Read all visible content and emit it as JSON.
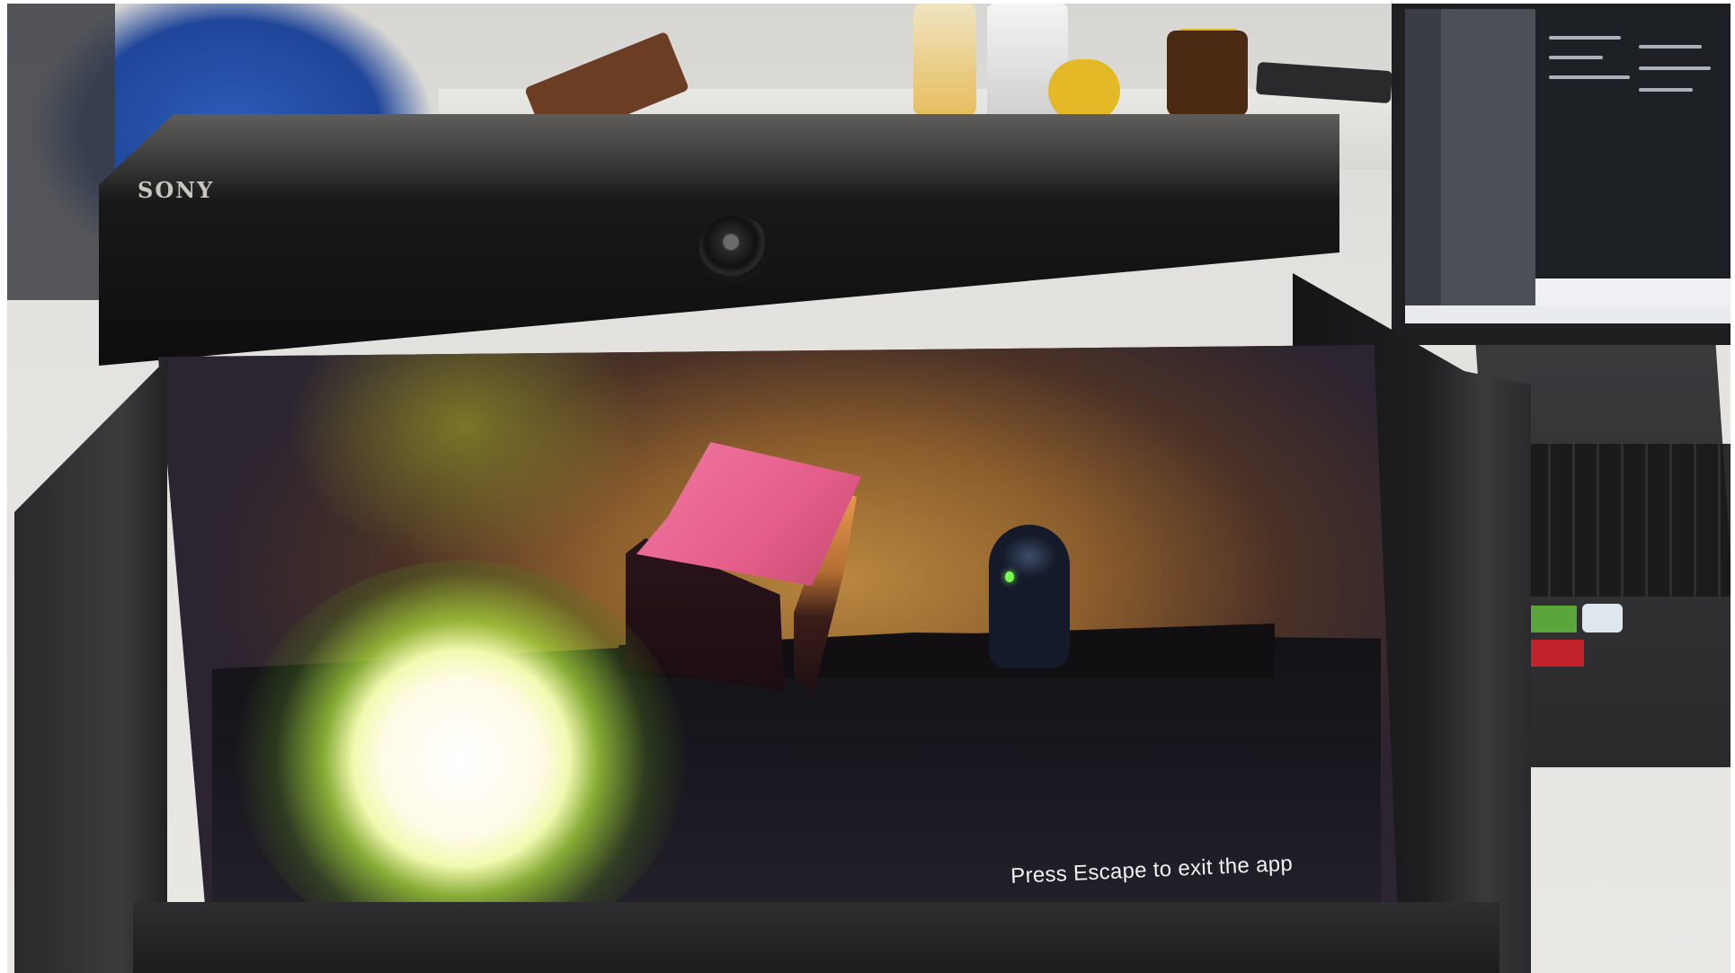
{
  "device": {
    "brand_logo": "SONY"
  },
  "app": {
    "exit_hint": "Press Escape to exit the app"
  },
  "scene": {
    "objects": [
      "pink-cube",
      "dark-capsule-character",
      "glowing-green-orb",
      "amber-backdrop",
      "black-floor"
    ]
  },
  "colors": {
    "cube_top": "#e55d8a",
    "cube_side": "#e99b4e",
    "backdrop": "#b9873f",
    "glow": "#f2f9b0",
    "capsule": "#141a2a"
  }
}
